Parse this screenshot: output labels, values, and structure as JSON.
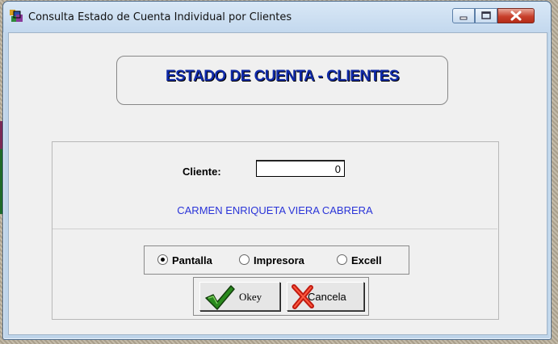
{
  "window": {
    "title": "Consulta Estado de Cuenta Individual por Clientes",
    "icons": {
      "app": "app-icon",
      "minimize": "minimize-icon",
      "maximize": "maximize-icon",
      "close": "close-icon"
    }
  },
  "header": {
    "title": "ESTADO DE CUENTA - CLIENTES"
  },
  "form": {
    "cliente_label": "Cliente:",
    "cliente_value": "0",
    "cliente_name": "CARMEN ENRIQUETA VIERA CABRERA"
  },
  "output": {
    "options": [
      {
        "label": "Pantalla",
        "selected": true
      },
      {
        "label": "Impresora",
        "selected": false
      },
      {
        "label": "Excell",
        "selected": false
      }
    ]
  },
  "buttons": {
    "ok_label": "Okey",
    "cancel_label": "Cancela"
  },
  "colors": {
    "title_text": "#102aa8",
    "client_name": "#2a34d8",
    "close_button": "#c8402c"
  }
}
